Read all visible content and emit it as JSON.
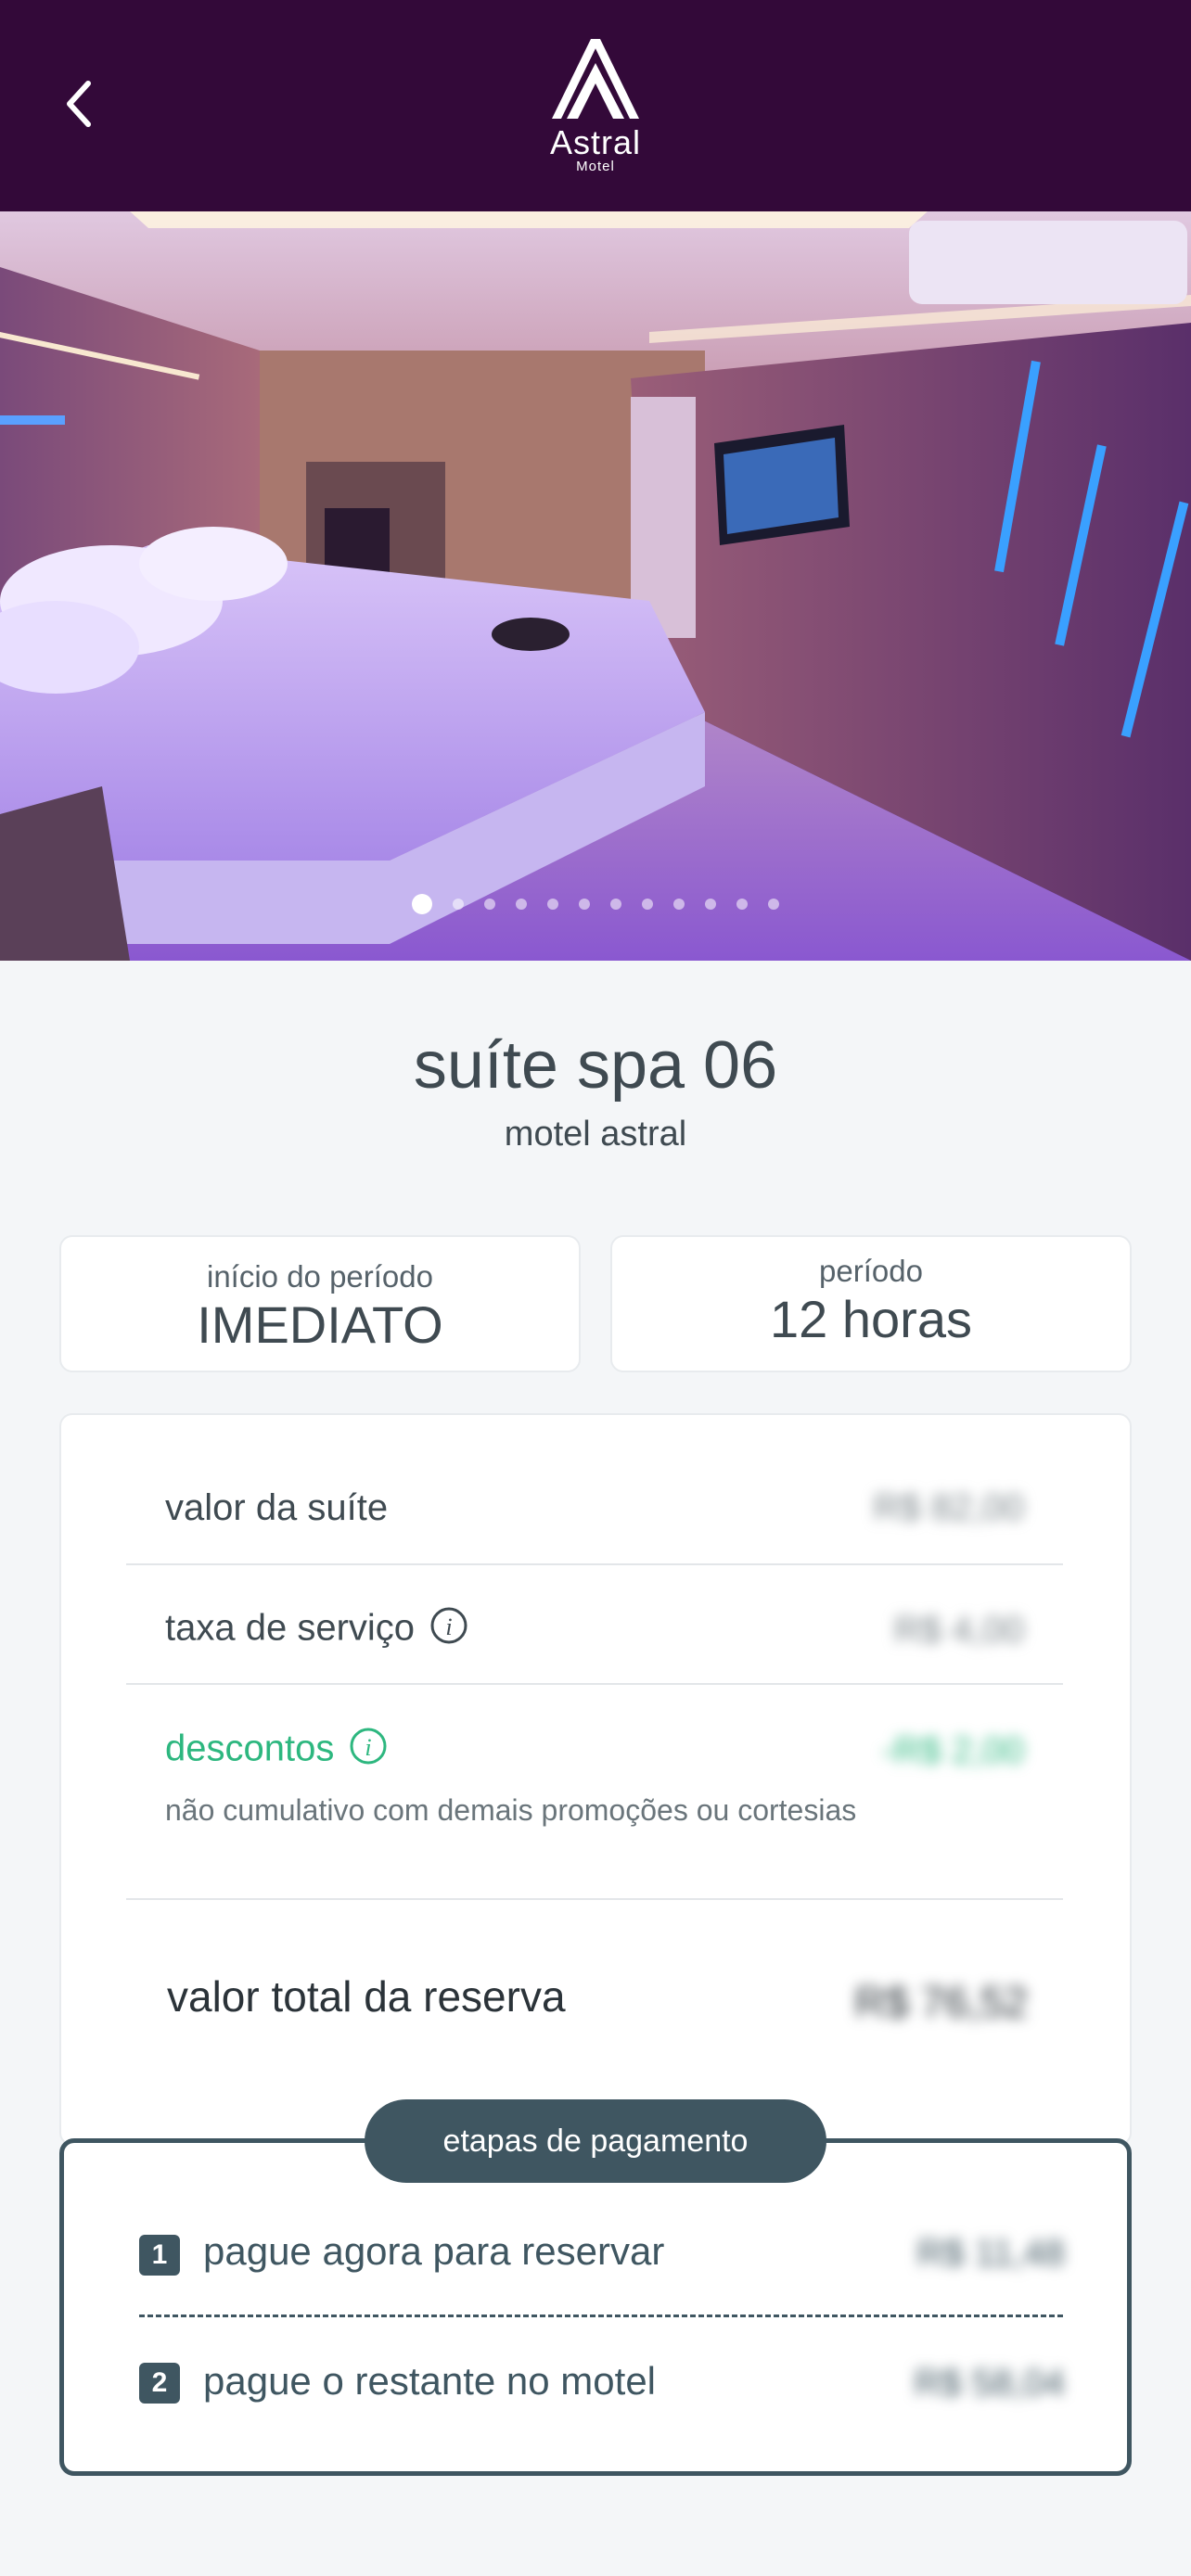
{
  "header": {
    "logo_word": "Astral",
    "logo_sub": "Motel"
  },
  "carousel": {
    "dot_count": 12,
    "active_index": 0
  },
  "suite": {
    "title": "suíte spa 06",
    "motel": "motel astral"
  },
  "period": {
    "start_label": "início do período",
    "start_value": "IMEDIATO",
    "duration_label": "período",
    "duration_value": "12 horas"
  },
  "pricing": {
    "suite_label": "valor da suíte",
    "suite_value": "R$ 82,00",
    "service_label": "taxa de serviço",
    "service_value": "R$ 4,00",
    "discount_label": "descontos",
    "discount_value": "-R$ 2,00",
    "discount_note": "não cumulativo com demais promoções ou cortesias",
    "total_label": "valor total da reserva",
    "total_value": "R$ 76,52"
  },
  "payment": {
    "title": "etapas de pagamento",
    "step1_number": "1",
    "step1_label": "pague agora para reservar",
    "step1_value": "R$ 11,48",
    "step2_number": "2",
    "step2_label": "pague o restante no motel",
    "step2_value": "R$ 58,04"
  },
  "colors": {
    "header_bg": "#330939",
    "accent_dark": "#3f5661",
    "discount_green": "#2db77f"
  }
}
